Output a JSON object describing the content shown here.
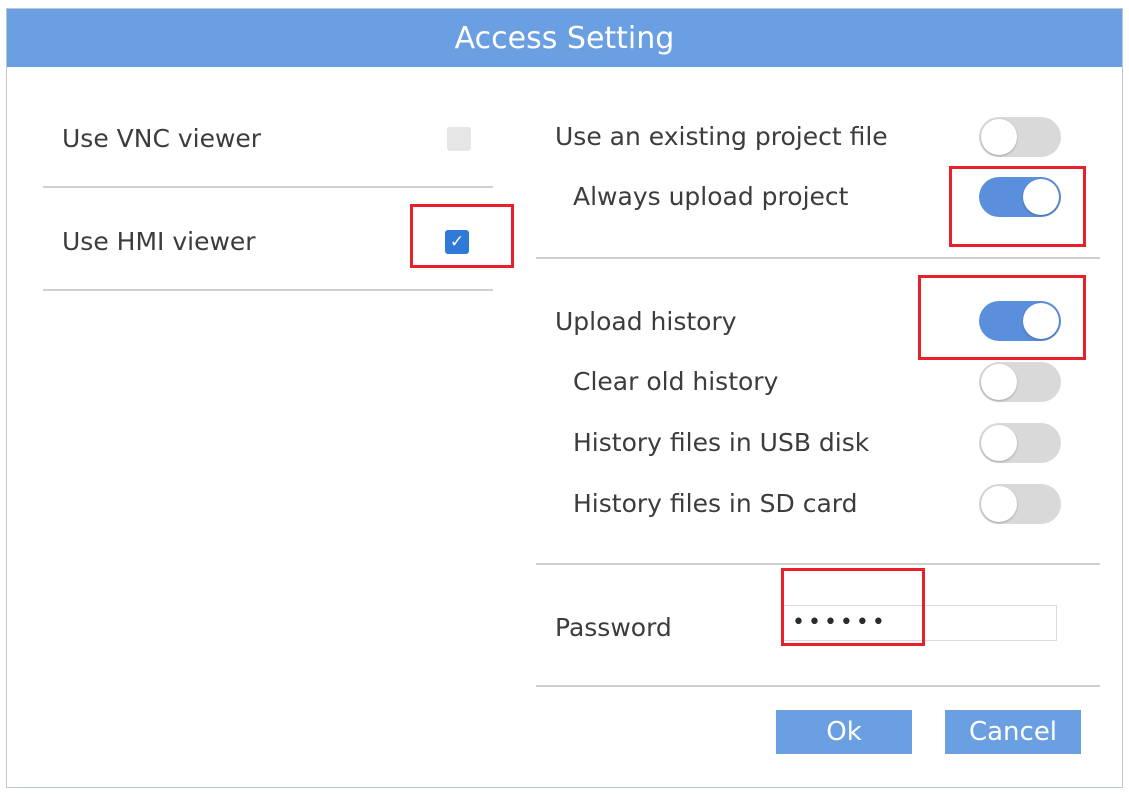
{
  "dialog": {
    "title": "Access Setting"
  },
  "left": {
    "vnc": {
      "label": "Use VNC viewer",
      "checked": false
    },
    "hmi": {
      "label": "Use HMI viewer",
      "checked": true,
      "check_glyph": "✓"
    }
  },
  "right": {
    "existing_project": {
      "label": "Use an existing project file",
      "on": false
    },
    "always_upload": {
      "label": "Always upload project",
      "on": true
    },
    "upload_history": {
      "label": "Upload history",
      "on": true
    },
    "clear_old_history": {
      "label": "Clear old history",
      "on": false
    },
    "usb_history": {
      "label": "History files in USB disk",
      "on": false
    },
    "sd_history": {
      "label": "History files in SD card",
      "on": false
    },
    "password": {
      "label": "Password",
      "value": "••••••"
    }
  },
  "buttons": {
    "ok": "Ok",
    "cancel": "Cancel"
  },
  "colors": {
    "accent": "#6a9fe2",
    "toggle_on": "#5a8fdc",
    "toggle_off": "#d9d9d9",
    "highlight": "#e8202a"
  }
}
